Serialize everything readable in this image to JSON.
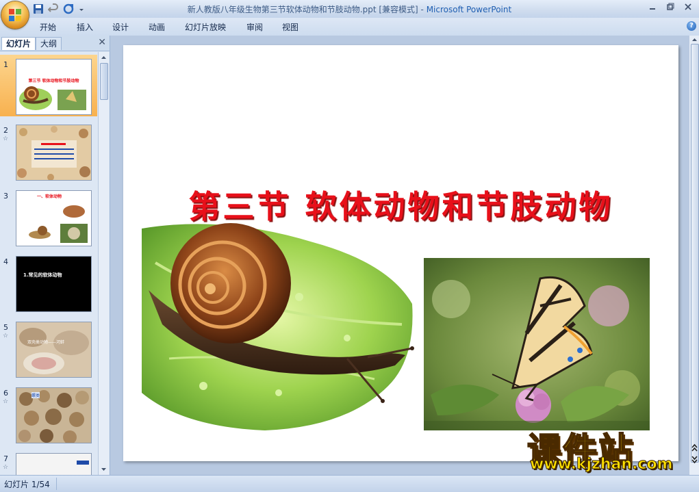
{
  "window": {
    "title_doc": "新人教版八年级生物第三节软体动物和节肢动物.ppt [兼容模式]",
    "title_sep": " - ",
    "title_app": "Microsoft PowerPoint"
  },
  "ribbon": {
    "tabs": [
      "开始",
      "插入",
      "设计",
      "动画",
      "幻灯片放映",
      "审阅",
      "视图"
    ]
  },
  "left_pane": {
    "tab_slides": "幻灯片",
    "tab_outline": "大纲",
    "thumbnails": [
      {
        "num": "1",
        "title": "第三节 软体动物和节肢动物",
        "selected": true
      },
      {
        "num": "2",
        "title": "第一目标",
        "has_anim": true
      },
      {
        "num": "3",
        "title": "一、软体动物"
      },
      {
        "num": "4",
        "title": "1.常见的软体动物"
      },
      {
        "num": "5",
        "title": "双壳类动物——河蚌",
        "has_anim": true
      },
      {
        "num": "6",
        "title": "螺类",
        "has_anim": true
      },
      {
        "num": "7",
        "title": "",
        "has_anim": true
      }
    ]
  },
  "slide": {
    "title": "第三节 软体动物和节肢动物"
  },
  "watermark": {
    "brand": "课件站",
    "url": "www.kjzhan.com"
  },
  "status": {
    "slide_counter": "幻灯片 1/54"
  },
  "colors": {
    "title_red": "#e8101a",
    "selection_orange": "#f8b14f",
    "watermark_yellow": "#ffde00"
  }
}
